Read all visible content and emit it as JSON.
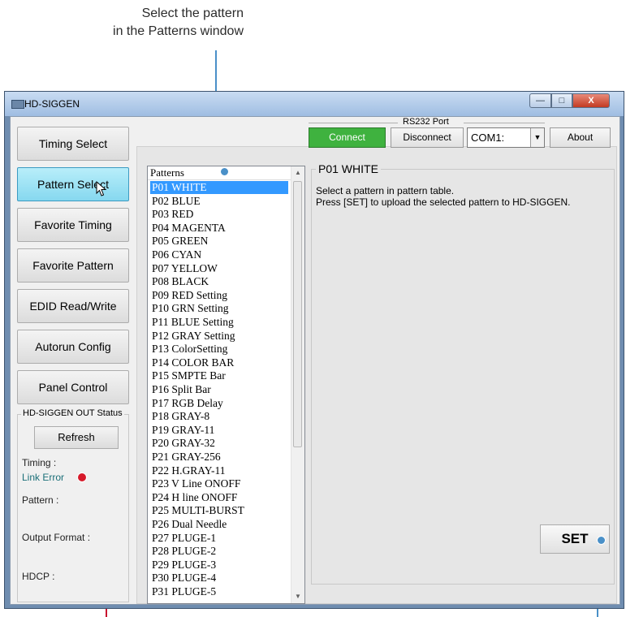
{
  "annotation": {
    "line1": "Select the pattern",
    "line2": "in the Patterns window"
  },
  "window": {
    "title": "HD-SIGGEN",
    "controls": {
      "minimize": "—",
      "maximize": "□",
      "close": "X"
    }
  },
  "nav": [
    "Timing Select",
    "Pattern Select",
    "Favorite Timing",
    "Favorite Pattern",
    "EDID Read/Write",
    "Autorun Config",
    "Panel Control"
  ],
  "status": {
    "title": "HD-SIGGEN OUT Status",
    "refresh": "Refresh",
    "timing_label": "Timing :",
    "timing_value": "Link Error",
    "pattern_label": "Pattern :",
    "output_label": "Output Format :",
    "hdcp_label": "HDCP :"
  },
  "rs232": {
    "label": "RS232 Port",
    "connect": "Connect",
    "disconnect": "Disconnect",
    "port": "COM1:",
    "about": "About"
  },
  "patterns": {
    "header": "Patterns",
    "items": [
      "P01 WHITE",
      "P02 BLUE",
      "P03 RED",
      "P04 MAGENTA",
      "P05 GREEN",
      "P06 CYAN",
      "P07 YELLOW",
      "P08 BLACK",
      "P09 RED Setting",
      "P10 GRN Setting",
      "P11 BLUE Setting",
      "P12 GRAY Setting",
      "P13 ColorSetting",
      "P14 COLOR BAR",
      "P15 SMPTE Bar",
      "P16 Split Bar",
      "P17 RGB Delay",
      "P18 GRAY-8",
      "P19 GRAY-11",
      "P20 GRAY-32",
      "P21 GRAY-256",
      "P22 H.GRAY-11",
      "P23 V Line ONOFF",
      "P24 H line ONOFF",
      "P25 MULTI-BURST",
      "P26 Dual Needle",
      "P27 PLUGE-1",
      "P28 PLUGE-2",
      "P29 PLUGE-3",
      "P30 PLUGE-4",
      "P31 PLUGE-5"
    ]
  },
  "detail": {
    "title": "P01 WHITE",
    "line1": "Select a pattern in pattern table.",
    "line2": "Press [SET] to upload the selected pattern to HD-SIGGEN.",
    "set": "SET"
  },
  "colors": {
    "accent_blue": "#4a90c8",
    "accent_red": "#d61a2a",
    "connect_green": "#3fb23f",
    "selected_nav": "#86d8ef",
    "selected_item": "#3399ff"
  }
}
